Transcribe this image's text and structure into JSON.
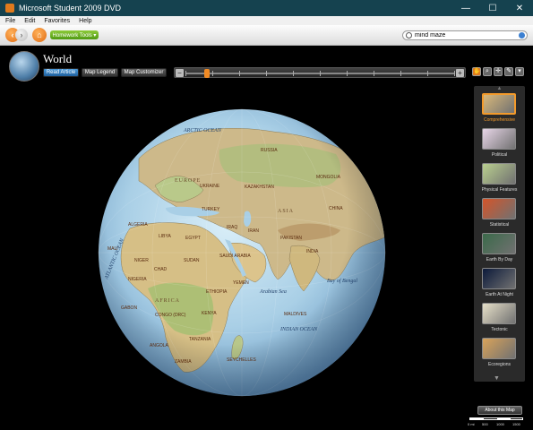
{
  "window": {
    "title": "Microsoft Student 2009 DVD",
    "controls": [
      "—",
      "☐",
      "✕"
    ]
  },
  "menu": [
    "File",
    "Edit",
    "Favorites",
    "Help"
  ],
  "toolbar": {
    "homework_tools": "Homework Tools ▾",
    "search_value": "mind maze"
  },
  "page": {
    "title": "World"
  },
  "tabs": [
    {
      "label": "Read Article",
      "active": true
    },
    {
      "label": "Map Legend",
      "active": false
    },
    {
      "label": "Map Customizer",
      "active": false
    }
  ],
  "zoom": {
    "minus": "−",
    "plus": "+",
    "level_fraction": 0.07
  },
  "map_styles": [
    {
      "label": "Comprehensive",
      "selected": true,
      "color": "#d9b87a"
    },
    {
      "label": "Political",
      "selected": false,
      "color": "#e8d6e8"
    },
    {
      "label": "Physical Features",
      "selected": false,
      "color": "#b9cf8f"
    },
    {
      "label": "Statistical",
      "selected": false,
      "color": "#d4552a"
    },
    {
      "label": "Earth By Day",
      "selected": false,
      "color": "#3b6a4a"
    },
    {
      "label": "Earth At Night",
      "selected": false,
      "color": "#0c1a3a"
    },
    {
      "label": "Tectonic",
      "selected": false,
      "color": "#e6e0c8"
    },
    {
      "label": "Ecoregions",
      "selected": false,
      "color": "#d9a35a"
    }
  ],
  "about_button": "About this Map",
  "scale": {
    "labels": [
      "0 mi",
      "500",
      "1000",
      "1500"
    ]
  },
  "map_labels": {
    "oceans": [
      "ARCTIC OCEAN",
      "ATLANTIC OCEAN",
      "INDIAN OCEAN",
      "Arabian Sea",
      "Bay of Bengal"
    ],
    "regions": [
      "EUROPE",
      "ASIA",
      "AFRICA"
    ],
    "countries": [
      "RUSSIA",
      "KAZAKHSTAN",
      "MONGOLIA",
      "CHINA",
      "UKRAINE",
      "TURKEY",
      "IRAN",
      "INDIA",
      "ALGERIA",
      "LIBYA",
      "EGYPT",
      "SUDAN",
      "CHAD",
      "NIGER",
      "MALI",
      "NIGERIA",
      "ETHIOPIA",
      "KENYA",
      "CONGO (DRC)",
      "ANGOLA",
      "TANZANIA",
      "ZAMBIA",
      "GABON",
      "SAUDI ARABIA",
      "YEMEN",
      "MALDIVES",
      "SEYCHELLES",
      "PAKISTAN",
      "IRAQ"
    ]
  },
  "colors": {
    "accent": "#f39a2b",
    "titlebar": "#15424f",
    "active_tab": "#2f78bd"
  }
}
